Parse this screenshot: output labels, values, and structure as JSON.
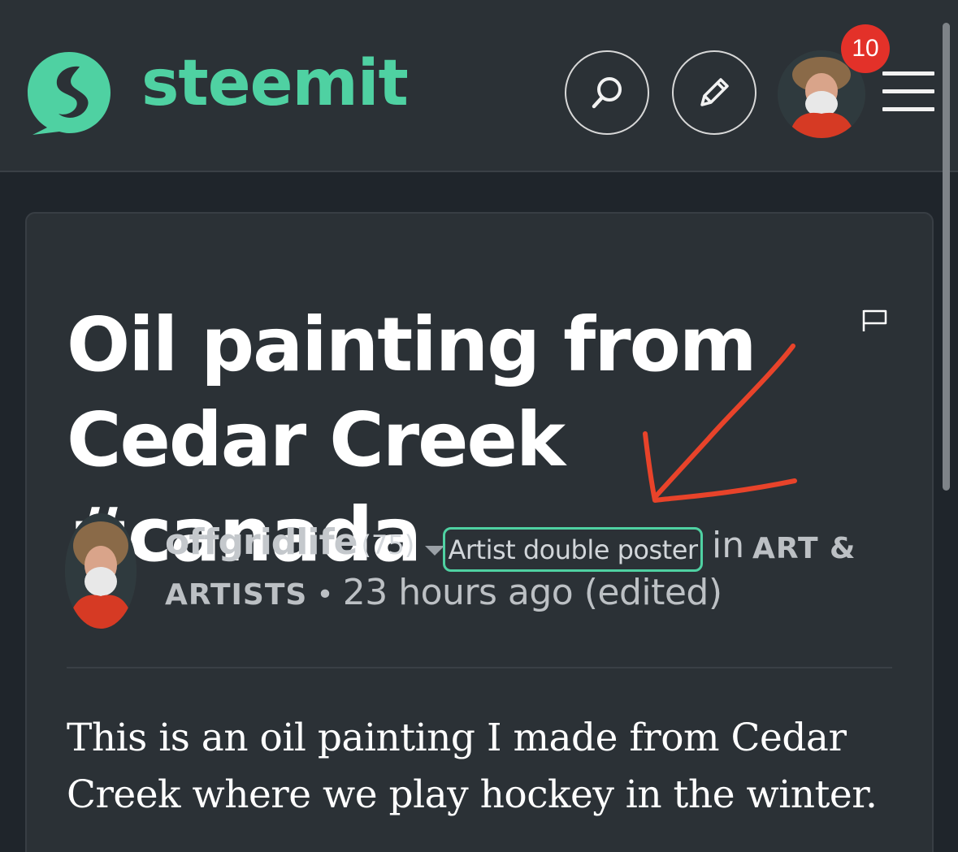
{
  "header": {
    "logo_text": "steemit",
    "notification_count": "10",
    "brand_color": "#4fd1a2",
    "badge_color": "#e33129",
    "icons": [
      "steemit-logo-icon",
      "search-icon",
      "pencil-icon",
      "avatar",
      "hamburger-menu-icon"
    ]
  },
  "post": {
    "title": "Oil painting from Cedar Creek #canada",
    "author": "offgridlife",
    "reputation": "(75)",
    "author_tag": "Artist double poster",
    "in_word": "in",
    "category_part1": "ART &",
    "category_part2": "ARTISTS",
    "separator": "•",
    "timestamp": "23 hours ago (edited)",
    "body": "This is an oil painting I made from Cedar Creek where we play hockey in the winter.",
    "flag_icon": "flag-icon"
  },
  "annotation": {
    "type": "arrow",
    "color": "#e8432a"
  }
}
